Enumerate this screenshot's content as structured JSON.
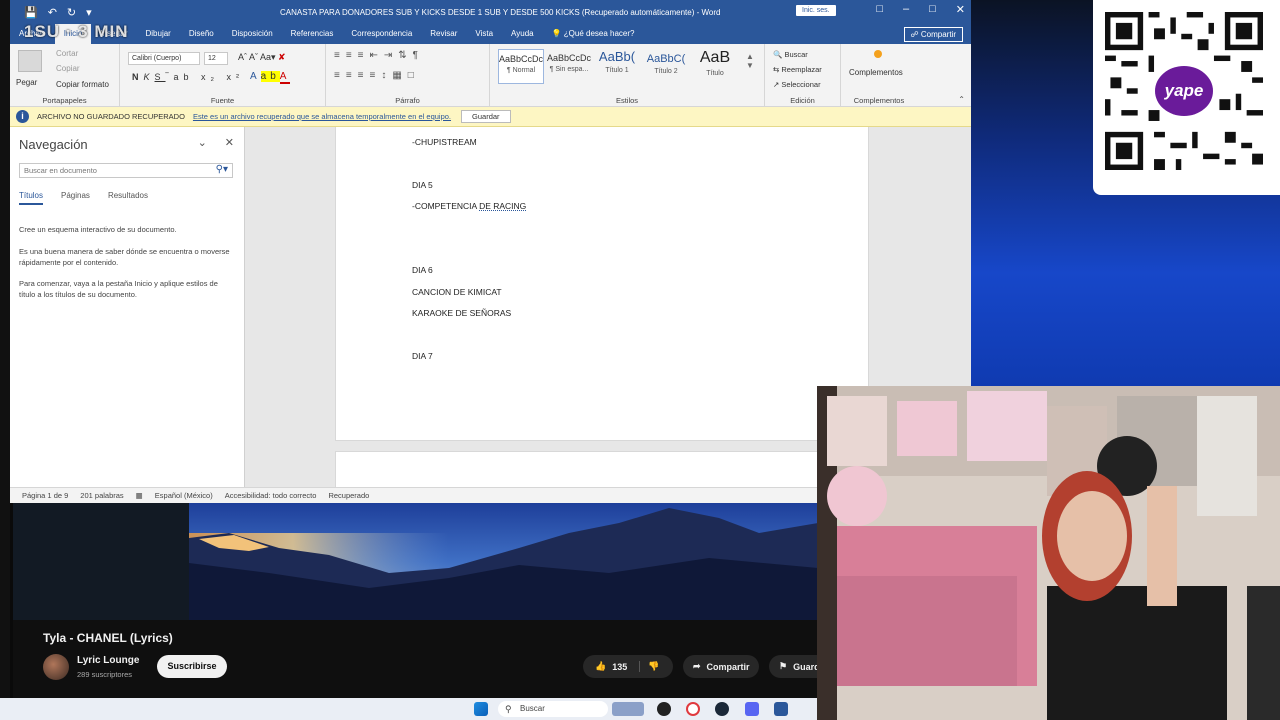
{
  "overlay": {
    "text": "1SU · 3 MIN"
  },
  "word": {
    "doc_title": "CANASTA PARA DONADORES SUB Y KICKS DESDE 1 SUB Y DESDE 500 KICKS (Recuperado automáticamente) - Word",
    "signin_label": "Inic. ses.",
    "share_label": "Compartir",
    "tabs": [
      "Archivo",
      "Inicio",
      "Insertar",
      "Dibujar",
      "Diseño",
      "Disposición",
      "Referencias",
      "Correspondencia",
      "Revisar",
      "Vista",
      "Ayuda"
    ],
    "tell_me": "¿Qué desea hacer?",
    "ribbon": {
      "clipboard_paste": "Pegar",
      "clipboard_cut": "Cortar",
      "clipboard_copy": "Copiar",
      "clipboard_format": "Copiar formato",
      "clipboard_label": "Portapapeles",
      "font_name": "Calibri (Cuerpo)",
      "font_size": "12",
      "font_label": "Fuente",
      "paragraph_label": "Párrafo",
      "styles_label": "Estilos",
      "styles": [
        {
          "preview": "AaBbCcDc",
          "name": "¶ Normal"
        },
        {
          "preview": "AaBbCcDc",
          "name": "¶ Sin espa..."
        },
        {
          "preview": "AaBb(",
          "name": "Título 1"
        },
        {
          "preview": "AaBbC(",
          "name": "Título 2"
        },
        {
          "preview": "AaB",
          "name": "Título"
        }
      ],
      "find": "Buscar",
      "replace": "Reemplazar",
      "select": "Seleccionar",
      "editing_label": "Edición",
      "addins": "Complementos",
      "addins_label": "Complementos"
    },
    "infobar": {
      "title": "ARCHIVO NO GUARDADO RECUPERADO",
      "message": "Este es un archivo recuperado que se almacena temporalmente en el equipo.",
      "save_label": "Guardar"
    },
    "nav": {
      "title": "Navegación",
      "search_placeholder": "Buscar en documento",
      "tabs": [
        "Títulos",
        "Páginas",
        "Resultados"
      ],
      "p1": "Cree un esquema interactivo de su documento.",
      "p2": "Es una buena manera de saber dónde se encuentra o moverse rápidamente por el contenido.",
      "p3": "Para comenzar, vaya a la pestaña Inicio y aplique estilos de título a los títulos de su documento."
    },
    "doc": {
      "l1": "-CHUPISTREAM",
      "l2": "DIA 5",
      "l3_prefix": "-COMPETENCIA ",
      "l3_link": "DE  RACING",
      "l4": "DIA 6",
      "l5": "CANCION DE KIMICAT",
      "l6": "KARAOKE DE SEÑORAS",
      "l7": "DIA 7"
    },
    "status": {
      "page": "Página 1 de 9",
      "words": "201 palabras",
      "language": "Español (México)",
      "accessibility": "Accesibilidad: todo correcto",
      "recovered": "Recuperado"
    }
  },
  "yape": {
    "logo": "yape"
  },
  "youtube": {
    "title": "Tyla - CHANEL (Lyrics)",
    "channel": "Lyric Lounge",
    "subscribers": "289 suscriptores",
    "subscribe_label": "Suscribirse",
    "likes": "135",
    "share_label": "Compartir",
    "save_label": "Guardar"
  },
  "taskbar": {
    "search_label": "Buscar"
  }
}
